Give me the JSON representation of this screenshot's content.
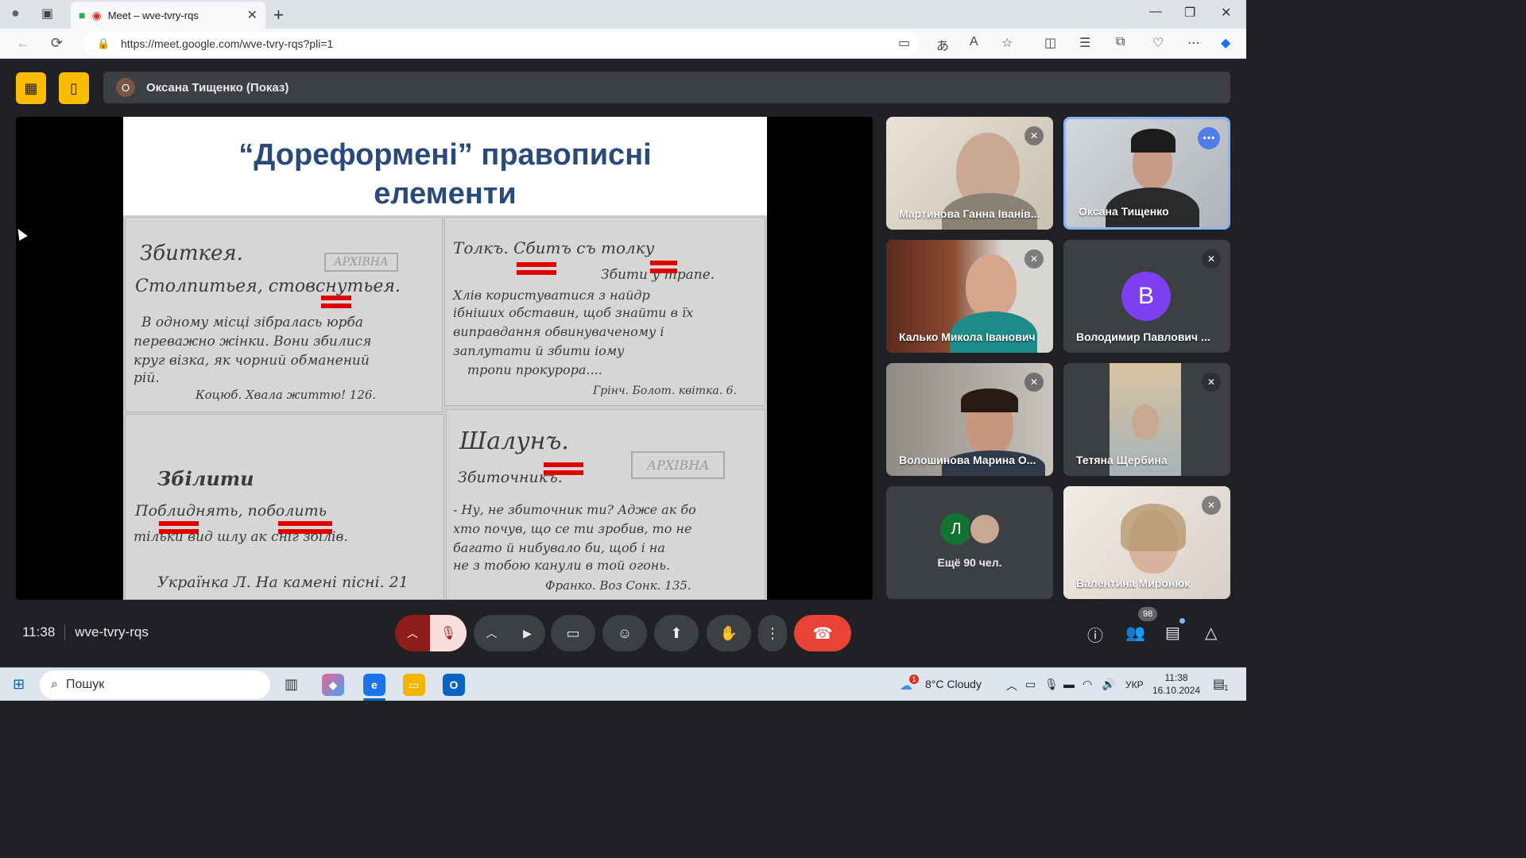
{
  "browser": {
    "tab_title": "Meet – wve-tvry-rqs",
    "url": "https://meet.google.com/wve-tvry-rqs?pli=1"
  },
  "meet": {
    "presenter_initial": "О",
    "presenter_label": "Оксана Тищенко (Показ)",
    "slide": {
      "title_line1": "“Дореформені” правописні",
      "title_line2": "елементи",
      "scan1": {
        "l1": "Збиткея.",
        "l2": "Столпитьея, стовснутьея.",
        "l3": "В одному місці зібралась юрба",
        "l4": "переважно жінки. Вони збилися",
        "l5": "круг візка, як чорний обманений",
        "l6": "рій.",
        "l7": "Коцюб. Хвала життю! 126."
      },
      "scan2": {
        "l1": "Толкъ.   Сбитъ съ толку",
        "l2": "Збити у трапе.",
        "l3": "Хлів користуватися з найдр",
        "l4": "ібніших обставин, щоб знайти в їх",
        "l5": "виправдання обвинуваченому і",
        "l6": "заплутати й збити іому",
        "l7": "тропи прокурора....",
        "l8": "Грінч. Болот. квітка. 6."
      },
      "scan3": {
        "l1": "Збілити",
        "l2": "Поблиднять, поболить",
        "l3": "тільки вид шлу ак сніг збілів.",
        "l4": "Українка Л. На камені пісні. 21"
      },
      "scan4": {
        "l1": "Шалунъ.",
        "l2": "Збиточникъ.",
        "l3": "- Ну, не збиточник ти? Адже ак бо",
        "l4": "хто почув, що се ти зробив, то не",
        "l5": "багато й нибувало би, щоб і на",
        "l6": "не з тобою канули в той огонь.",
        "l7": "Франко. Воз Сонк. 135.",
        "stamp": "АРХІВНА"
      },
      "stamp1": "АРХІВНА"
    },
    "participants": [
      {
        "name": "Мартинова Ганна Іванів..."
      },
      {
        "name": "Оксана Тищенко"
      },
      {
        "name": "Калько Микола Іванович"
      },
      {
        "name": "Володимир Павлович ...",
        "initial": "В"
      },
      {
        "name": "Волошинова Марина О..."
      },
      {
        "name": "Тетяна Щербина"
      },
      {
        "name": "Ещё 90 чел.",
        "initial": "Л"
      },
      {
        "name": "Валентина Миронюк"
      }
    ],
    "time": "11:38",
    "meeting_code": "wve-tvry-rqs",
    "people_count": "98"
  },
  "taskbar": {
    "search_placeholder": "Пошук",
    "weather": "8°C  Cloudy",
    "weather_alert": "1",
    "language": "УКР",
    "clock_time": "11:38",
    "clock_date": "16.10.2024",
    "notifications": "1"
  },
  "colors": {
    "meet_bg": "#202124",
    "tile_bg": "#3c4043",
    "accent_yellow": "#fbbc04",
    "hangup_red": "#ea4335",
    "slide_title": "#2a4a7a",
    "active_border": "#8ab4f8"
  }
}
